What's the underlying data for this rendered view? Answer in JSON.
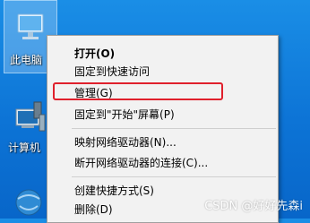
{
  "desktop": {
    "icons": [
      {
        "label": "此电脑",
        "icon": "computer-icon"
      },
      {
        "label": "计算机",
        "icon": "computer-management-icon"
      },
      {
        "label": "",
        "icon": "network-icon"
      }
    ]
  },
  "context_menu": {
    "items": [
      {
        "label": "打开(O)",
        "bold": true
      },
      {
        "label": "固定到快速访问"
      },
      {
        "label": "管理(G)"
      },
      {
        "label": "固定到\"开始\"屏幕(P)"
      },
      {
        "label": "映射网络驱动器(N)..."
      },
      {
        "label": "断开网络驱动器的连接(C)..."
      },
      {
        "label": "创建快捷方式(S)"
      },
      {
        "label": "删除(D)"
      }
    ],
    "highlight_color": "#e0202c"
  },
  "watermark": "CSDN @好好先森i"
}
